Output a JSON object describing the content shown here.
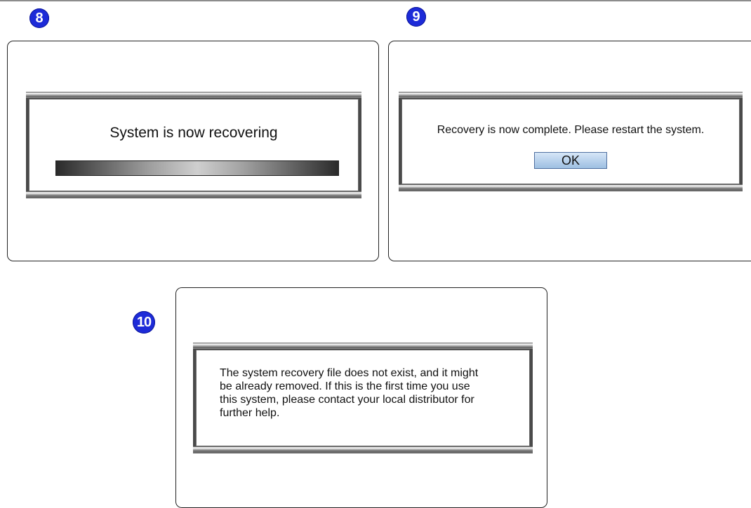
{
  "steps": [
    {
      "number": "8"
    },
    {
      "number": "9"
    },
    {
      "number": "10"
    }
  ],
  "panel8": {
    "message": "System is now recovering",
    "progress": 1.0
  },
  "panel9": {
    "message": "Recovery is now complete. Please restart the system.",
    "ok_label": "OK"
  },
  "panel10": {
    "message_lines": [
      "The system recovery file does not exist, and it might",
      "be already removed. If this is the first time you use",
      "this system, please contact your local distributor for",
      "further help."
    ]
  },
  "colors": {
    "badge": "#1d2bd8",
    "dialog_frame": "#4a4a4a",
    "ok_button": "#b8d2ee"
  }
}
